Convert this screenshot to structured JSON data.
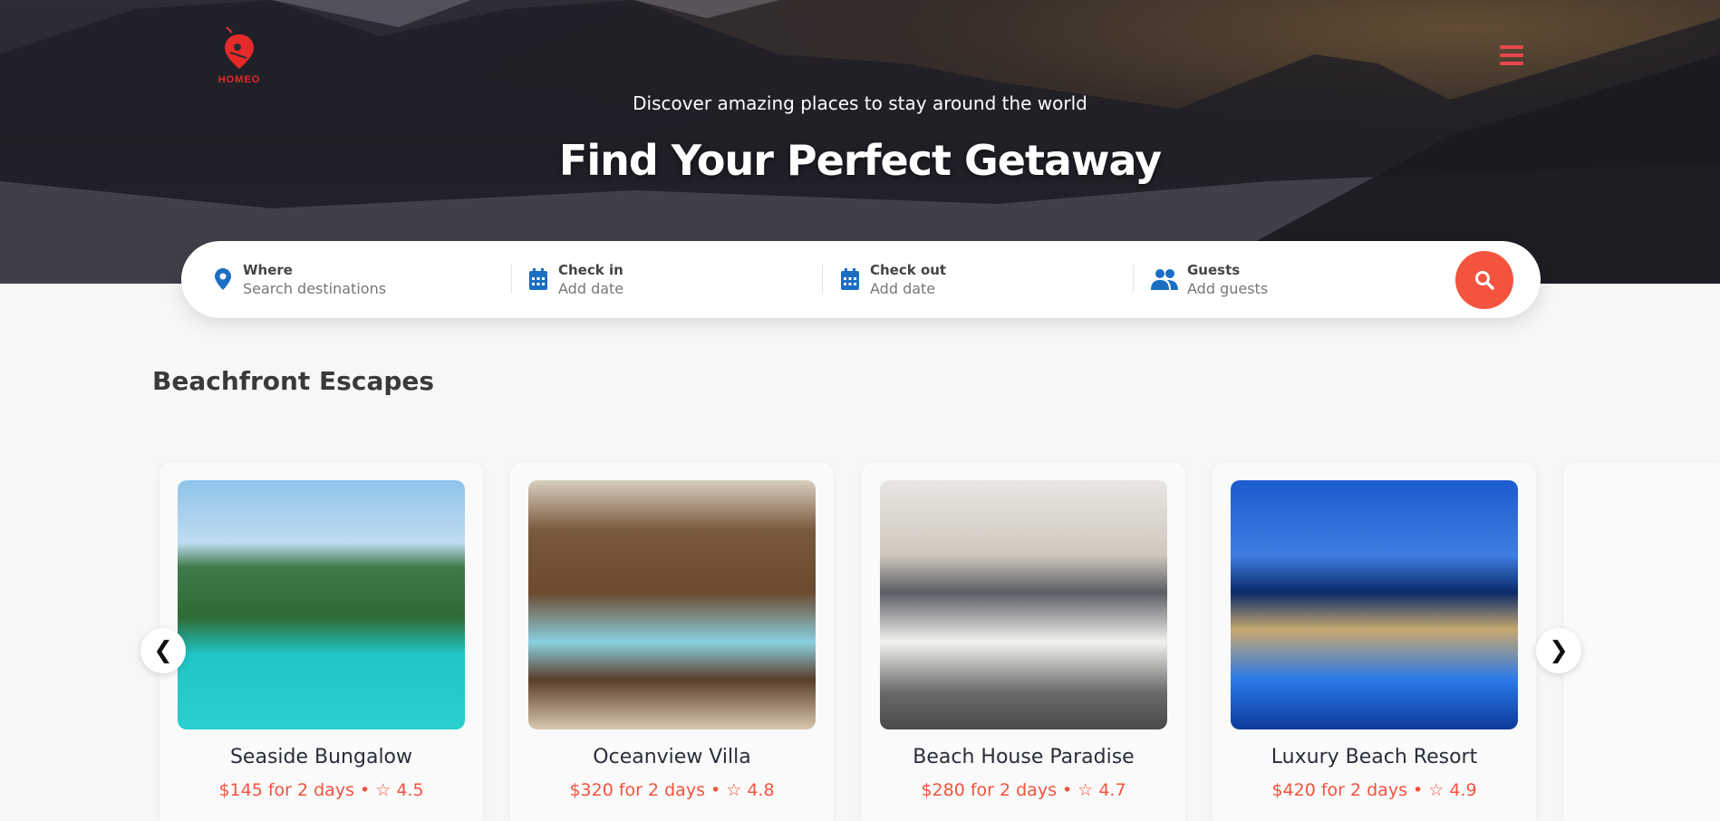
{
  "brand": {
    "name": "HOMEO",
    "accent": "#e52a2a"
  },
  "hero": {
    "subtitle": "Discover amazing places to stay around the world",
    "title": "Find Your Perfect Getaway"
  },
  "search": {
    "fields": [
      {
        "label": "Where",
        "placeholder": "Search destinations",
        "icon": "map-pin-icon"
      },
      {
        "label": "Check in",
        "placeholder": "Add date",
        "icon": "calendar-icon"
      },
      {
        "label": "Check out",
        "placeholder": "Add date",
        "icon": "calendar-icon"
      },
      {
        "label": "Guests",
        "placeholder": "Add guests",
        "icon": "users-icon"
      }
    ],
    "button_color": "#f4533e"
  },
  "section": {
    "title": "Beachfront Escapes"
  },
  "carousel": {
    "prev": "❮",
    "next": "❯"
  },
  "listings": [
    {
      "name": "Seaside Bungalow",
      "price": "$145 for 2 days • ☆ 4.5"
    },
    {
      "name": "Oceanview Villa",
      "price": "$320 for 2 days • ☆ 4.8"
    },
    {
      "name": "Beach House Paradise",
      "price": "$280 for 2 days • ☆ 4.7"
    },
    {
      "name": "Luxury Beach Resort",
      "price": "$420 for 2 days • ☆ 4.9"
    }
  ]
}
